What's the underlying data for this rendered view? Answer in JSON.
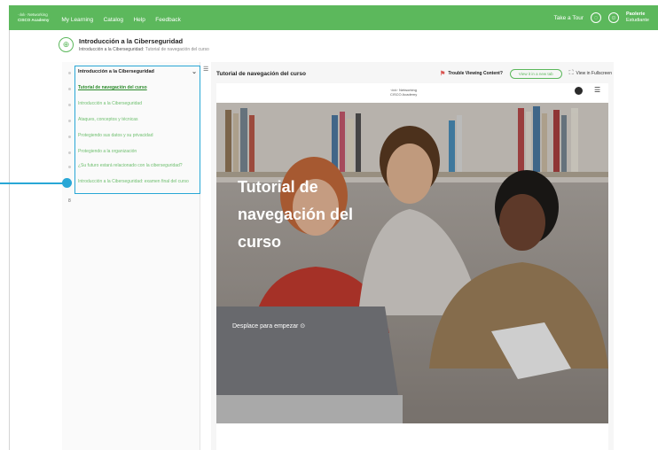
{
  "header": {
    "logo_line1": "·ılıılı· Networking",
    "logo_line2": "CISCO Academy",
    "nav": [
      "My Learning",
      "Catalog",
      "Help",
      "Feedback"
    ],
    "take_tour": "Take a Tour",
    "user_name": "Paolerie",
    "user_role": "Estudiante"
  },
  "module": {
    "icon": "⊕",
    "title": "Introducción a la Ciberseguridad",
    "breadcrumb_current": "Introducción a la Ciberseguridad:",
    "breadcrumb_page": "Tutorial de navegación del curso"
  },
  "toc": {
    "heading": "Introducción a la Ciberseguridad",
    "items": [
      "Tutorial de navegación del curso",
      "Introducción a la Ciberseguridad",
      "Ataques, conceptos y técnicas",
      "Protegiendo sus datos y su privacidad",
      "Protegiendo a la organización",
      "¿Su futuro estará relacionado con la ciberseguridad?",
      "Introducción a la Ciberseguridad: examen final del curso"
    ],
    "extra": "8"
  },
  "content": {
    "title": "Tutorial de navegación del curso",
    "trouble": "Trouble Viewing Content?",
    "view_button": "View it in a new tab",
    "fullscreen": "View in Fullscreen"
  },
  "inner": {
    "logo_line1": "·ılıılı· Networking",
    "logo_line2": "CISCO Academy"
  },
  "hero": {
    "title_lines": [
      "Tutorial de",
      "navegación del",
      "curso"
    ],
    "cta": "Desplace para empezar ⊙"
  }
}
